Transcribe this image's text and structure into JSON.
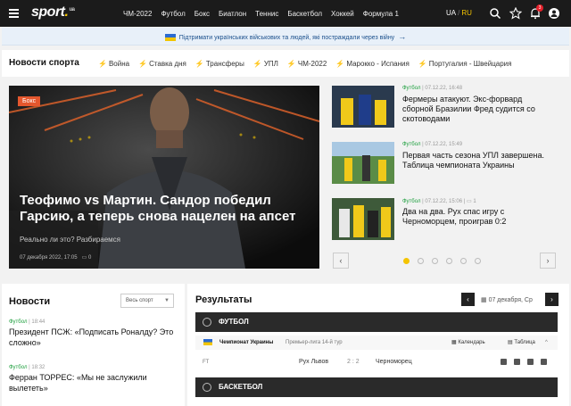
{
  "logo": {
    "text": "sport",
    "dot": ".",
    "suffix": "ua"
  },
  "nav": [
    "ЧМ-2022",
    "Футбол",
    "Бокс",
    "Биатлон",
    "Теннис",
    "Баскетбол",
    "Хоккей",
    "Формула 1"
  ],
  "lang": {
    "ua": "UA",
    "sep": "/",
    "ru": "RU"
  },
  "notifications": {
    "count": "3"
  },
  "banner": {
    "text": "Підтримати українських військових та людей, які постраждали через війну"
  },
  "sport_news": {
    "title": "Новости спорта",
    "tags": [
      "Война",
      "Ставка дня",
      "Трансферы",
      "УПЛ",
      "ЧМ-2022",
      "Марокко - Испания",
      "Португалия - Швейцария"
    ]
  },
  "hero": {
    "label": "Бокс",
    "title": "Теофимо vs Мартин. Сандор победил Гарсию, а теперь снова нацелен на апсет",
    "subtitle": "Реально ли это? Разбираемся",
    "date": "07 декабря 2022, 17:05",
    "comments": "0"
  },
  "side_news": [
    {
      "category": "Футбол",
      "time": "07.12.22, 16:48",
      "title": "Фермеры атакуют. Экс-форвард сборной Бразилии Фред судится со скотоводами"
    },
    {
      "category": "Футбол",
      "time": "07.12.22, 15:49",
      "title": "Первая часть сезона УПЛ завершена. Таблица чемпионата Украины"
    },
    {
      "category": "Футбол",
      "time": "07.12.22, 15:06",
      "comments": "1",
      "title": "Два на два. Рух спас игру с Черноморцем, проиграв 0:2"
    }
  ],
  "news": {
    "title": "Новости",
    "filter": "Весь спорт",
    "items": [
      {
        "category": "Футбол",
        "time": "18:44",
        "title": "Президент ПСЖ: «Подписать Роналду? Это сложно»"
      },
      {
        "category": "Футбол",
        "time": "18:32",
        "title": "Ферран ТОРРЕС: «Мы не заслужили вылететь»"
      }
    ]
  },
  "results": {
    "title": "Результаты",
    "date": "07 декабря, Ср",
    "sports": [
      {
        "name": "ФУТБОЛ"
      },
      {
        "name": "БАСКЕТБОЛ"
      }
    ],
    "league": {
      "name": "Чемпионат Украины",
      "round": "Премьер-лига 14-й тур",
      "calendar": "Календарь",
      "table": "Таблица"
    },
    "match": {
      "status": "FT",
      "home": "Рух Львов",
      "score_home": "2",
      "score_sep": ":",
      "score_away": "2",
      "away": "Черноморец"
    }
  }
}
